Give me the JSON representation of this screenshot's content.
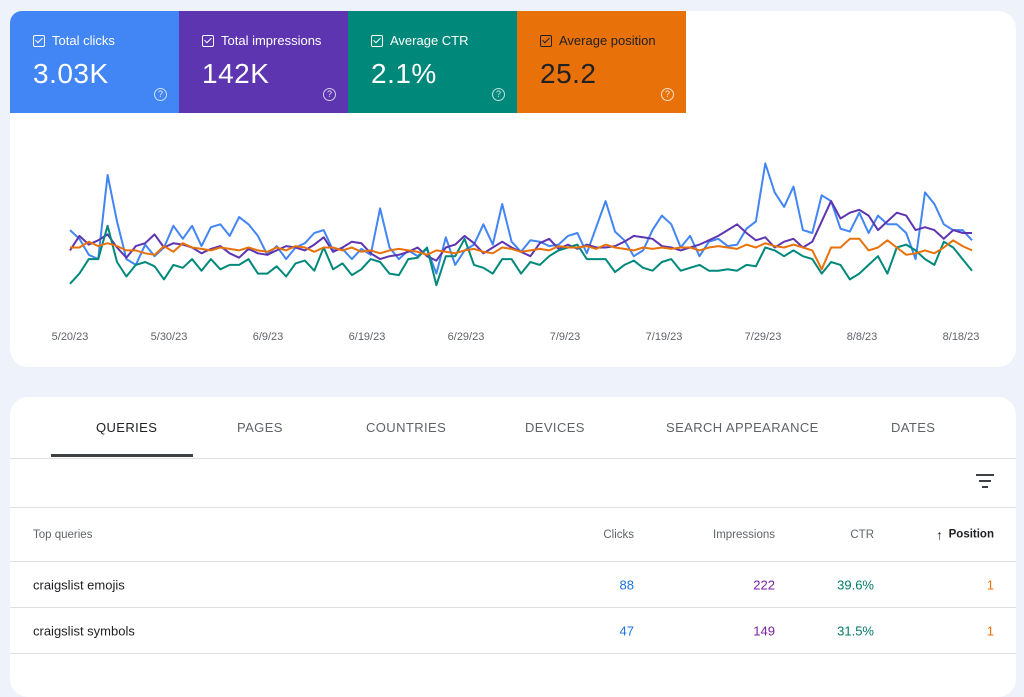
{
  "metrics": [
    {
      "label": "Total clicks",
      "value": "3.03K",
      "color": "#4285f4"
    },
    {
      "label": "Total impressions",
      "value": "142K",
      "color": "#5e35b1"
    },
    {
      "label": "Average CTR",
      "value": "2.1%",
      "color": "#00897b"
    },
    {
      "label": "Average position",
      "value": "25.2",
      "color": "#e8710a"
    }
  ],
  "chart_data": {
    "type": "line",
    "x_ticks": [
      "5/20/23",
      "5/30/23",
      "6/9/23",
      "6/19/23",
      "6/29/23",
      "7/9/23",
      "7/19/23",
      "7/29/23",
      "8/8/23",
      "8/18/23"
    ],
    "series": [
      {
        "color": "#4285f4",
        "values": [
          0.42,
          0.36,
          0.25,
          0.22,
          0.8,
          0.48,
          0.22,
          0.18,
          0.32,
          0.24,
          0.3,
          0.45,
          0.36,
          0.45,
          0.31,
          0.44,
          0.46,
          0.38,
          0.51,
          0.46,
          0.38,
          0.25,
          0.31,
          0.22,
          0.3,
          0.33,
          0.4,
          0.42,
          0.28,
          0.29,
          0.22,
          0.29,
          0.25,
          0.57,
          0.3,
          0.22,
          0.28,
          0.24,
          0.29,
          0.12,
          0.37,
          0.18,
          0.28,
          0.32,
          0.46,
          0.32,
          0.6,
          0.34,
          0.27,
          0.35,
          0.34,
          0.31,
          0.32,
          0.38,
          0.4,
          0.26,
          0.44,
          0.62,
          0.41,
          0.35,
          0.24,
          0.28,
          0.42,
          0.52,
          0.46,
          0.3,
          0.38,
          0.24,
          0.34,
          0.36,
          0.31,
          0.32,
          0.43,
          0.48,
          0.88,
          0.68,
          0.58,
          0.72,
          0.42,
          0.4,
          0.66,
          0.62,
          0.43,
          0.41,
          0.54,
          0.4,
          0.52,
          0.46,
          0.46,
          0.4,
          0.22,
          0.68,
          0.6,
          0.46,
          0.42,
          0.42,
          0.35
        ]
      },
      {
        "color": "#5e35b1",
        "values": [
          0.28,
          0.38,
          0.32,
          0.35,
          0.39,
          0.3,
          0.23,
          0.31,
          0.33,
          0.39,
          0.3,
          0.33,
          0.32,
          0.3,
          0.26,
          0.29,
          0.31,
          0.26,
          0.23,
          0.29,
          0.26,
          0.25,
          0.28,
          0.31,
          0.3,
          0.28,
          0.32,
          0.37,
          0.27,
          0.3,
          0.34,
          0.33,
          0.26,
          0.22,
          0.24,
          0.25,
          0.27,
          0.3,
          0.24,
          0.21,
          0.3,
          0.32,
          0.38,
          0.33,
          0.26,
          0.3,
          0.34,
          0.3,
          0.27,
          0.24,
          0.33,
          0.36,
          0.29,
          0.32,
          0.29,
          0.32,
          0.3,
          0.3,
          0.31,
          0.34,
          0.38,
          0.37,
          0.36,
          0.31,
          0.3,
          0.28,
          0.3,
          0.32,
          0.35,
          0.38,
          0.42,
          0.46,
          0.4,
          0.35,
          0.37,
          0.3,
          0.34,
          0.36,
          0.3,
          0.34,
          0.48,
          0.62,
          0.5,
          0.54,
          0.56,
          0.52,
          0.42,
          0.48,
          0.54,
          0.52,
          0.42,
          0.44,
          0.42,
          0.36,
          0.42,
          0.4,
          0.4
        ]
      },
      {
        "color": "#00897b",
        "values": [
          0.05,
          0.12,
          0.22,
          0.22,
          0.45,
          0.2,
          0.1,
          0.18,
          0.2,
          0.17,
          0.08,
          0.18,
          0.16,
          0.22,
          0.14,
          0.22,
          0.15,
          0.18,
          0.18,
          0.22,
          0.12,
          0.12,
          0.17,
          0.1,
          0.19,
          0.21,
          0.14,
          0.3,
          0.15,
          0.19,
          0.11,
          0.15,
          0.22,
          0.2,
          0.12,
          0.11,
          0.22,
          0.23,
          0.3,
          0.04,
          0.24,
          0.24,
          0.36,
          0.18,
          0.16,
          0.12,
          0.22,
          0.22,
          0.12,
          0.2,
          0.18,
          0.24,
          0.28,
          0.3,
          0.32,
          0.22,
          0.22,
          0.22,
          0.13,
          0.18,
          0.21,
          0.16,
          0.14,
          0.2,
          0.22,
          0.14,
          0.16,
          0.18,
          0.14,
          0.14,
          0.15,
          0.14,
          0.18,
          0.17,
          0.3,
          0.28,
          0.24,
          0.28,
          0.24,
          0.22,
          0.12,
          0.2,
          0.18,
          0.08,
          0.12,
          0.18,
          0.24,
          0.12,
          0.3,
          0.32,
          0.28,
          0.22,
          0.18,
          0.34,
          0.3,
          0.22,
          0.14
        ]
      },
      {
        "color": "#e8710a",
        "values": [
          0.3,
          0.3,
          0.34,
          0.31,
          0.33,
          0.31,
          0.28,
          0.28,
          0.26,
          0.25,
          0.31,
          0.27,
          0.33,
          0.3,
          0.29,
          0.28,
          0.3,
          0.29,
          0.28,
          0.3,
          0.28,
          0.27,
          0.3,
          0.28,
          0.31,
          0.3,
          0.27,
          0.3,
          0.3,
          0.28,
          0.3,
          0.27,
          0.28,
          0.26,
          0.28,
          0.29,
          0.28,
          0.27,
          0.25,
          0.28,
          0.27,
          0.26,
          0.28,
          0.29,
          0.27,
          0.26,
          0.3,
          0.29,
          0.27,
          0.28,
          0.29,
          0.28,
          0.31,
          0.3,
          0.3,
          0.31,
          0.29,
          0.32,
          0.3,
          0.29,
          0.28,
          0.3,
          0.29,
          0.3,
          0.29,
          0.3,
          0.3,
          0.28,
          0.3,
          0.31,
          0.3,
          0.29,
          0.32,
          0.3,
          0.33,
          0.31,
          0.3,
          0.32,
          0.3,
          0.28,
          0.15,
          0.3,
          0.3,
          0.36,
          0.36,
          0.28,
          0.3,
          0.35,
          0.3,
          0.25,
          0.26,
          0.28,
          0.26,
          0.3,
          0.35,
          0.31,
          0.28
        ]
      }
    ]
  },
  "tabs": [
    "QUERIES",
    "PAGES",
    "COUNTRIES",
    "DEVICES",
    "SEARCH APPEARANCE",
    "DATES"
  ],
  "table": {
    "headers": {
      "query": "Top queries",
      "clicks": "Clicks",
      "impressions": "Impressions",
      "ctr": "CTR",
      "position": "Position"
    },
    "rows": [
      {
        "query": "craigslist emojis",
        "clicks": "88",
        "impressions": "222",
        "ctr": "39.6%",
        "position": "1"
      },
      {
        "query": "craigslist symbols",
        "clicks": "47",
        "impressions": "149",
        "ctr": "31.5%",
        "position": "1"
      }
    ]
  }
}
